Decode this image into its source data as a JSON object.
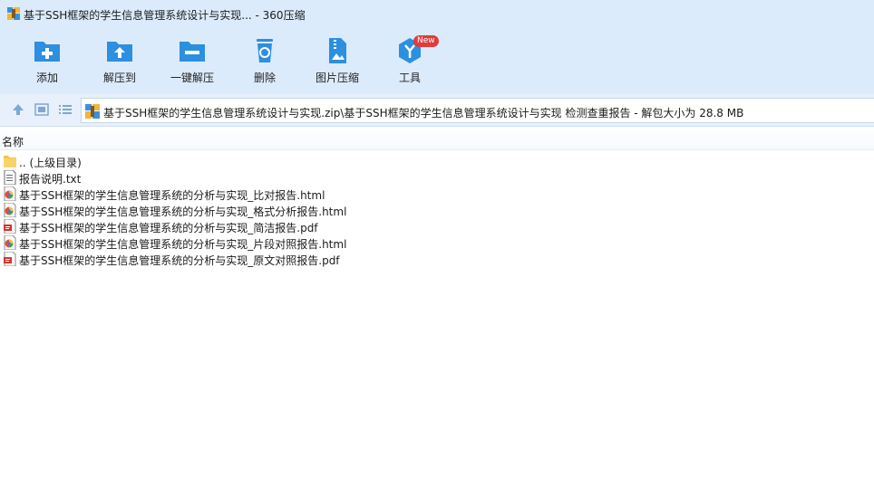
{
  "window": {
    "title": "基于SSH框架的学生信息管理系统设计与实现... - 360压缩"
  },
  "toolbar": {
    "items": [
      {
        "label": "添加",
        "icon": "add-folder-icon"
      },
      {
        "label": "解压到",
        "icon": "extract-to-icon"
      },
      {
        "label": "一键解压",
        "icon": "one-click-extract-icon"
      },
      {
        "label": "删除",
        "icon": "recycle-delete-icon"
      },
      {
        "label": "图片压缩",
        "icon": "image-compress-icon"
      },
      {
        "label": "工具",
        "icon": "tools-icon",
        "badge": "New"
      }
    ]
  },
  "nav": {
    "path": "基于SSH框架的学生信息管理系统设计与实现.zip\\基于SSH框架的学生信息管理系统设计与实现 检测查重报告 - 解包大小为 28.8 MB"
  },
  "list": {
    "column_name": "名称",
    "files": [
      {
        "name": ".. (上级目录)",
        "type": "folder"
      },
      {
        "name": "报告说明.txt",
        "type": "txt"
      },
      {
        "name": "基于SSH框架的学生信息管理系统的分析与实现_比对报告.html",
        "type": "html"
      },
      {
        "name": "基于SSH框架的学生信息管理系统的分析与实现_格式分析报告.html",
        "type": "html"
      },
      {
        "name": "基于SSH框架的学生信息管理系统的分析与实现_简洁报告.pdf",
        "type": "pdf"
      },
      {
        "name": "基于SSH框架的学生信息管理系统的分析与实现_片段对照报告.html",
        "type": "html"
      },
      {
        "name": "基于SSH框架的学生信息管理系统的分析与实现_原文对照报告.pdf",
        "type": "pdf"
      }
    ]
  },
  "colors": {
    "toolbar_bg": "#dcebfb",
    "icon_blue": "#2c8fe0",
    "badge_red": "#e23b3b"
  }
}
